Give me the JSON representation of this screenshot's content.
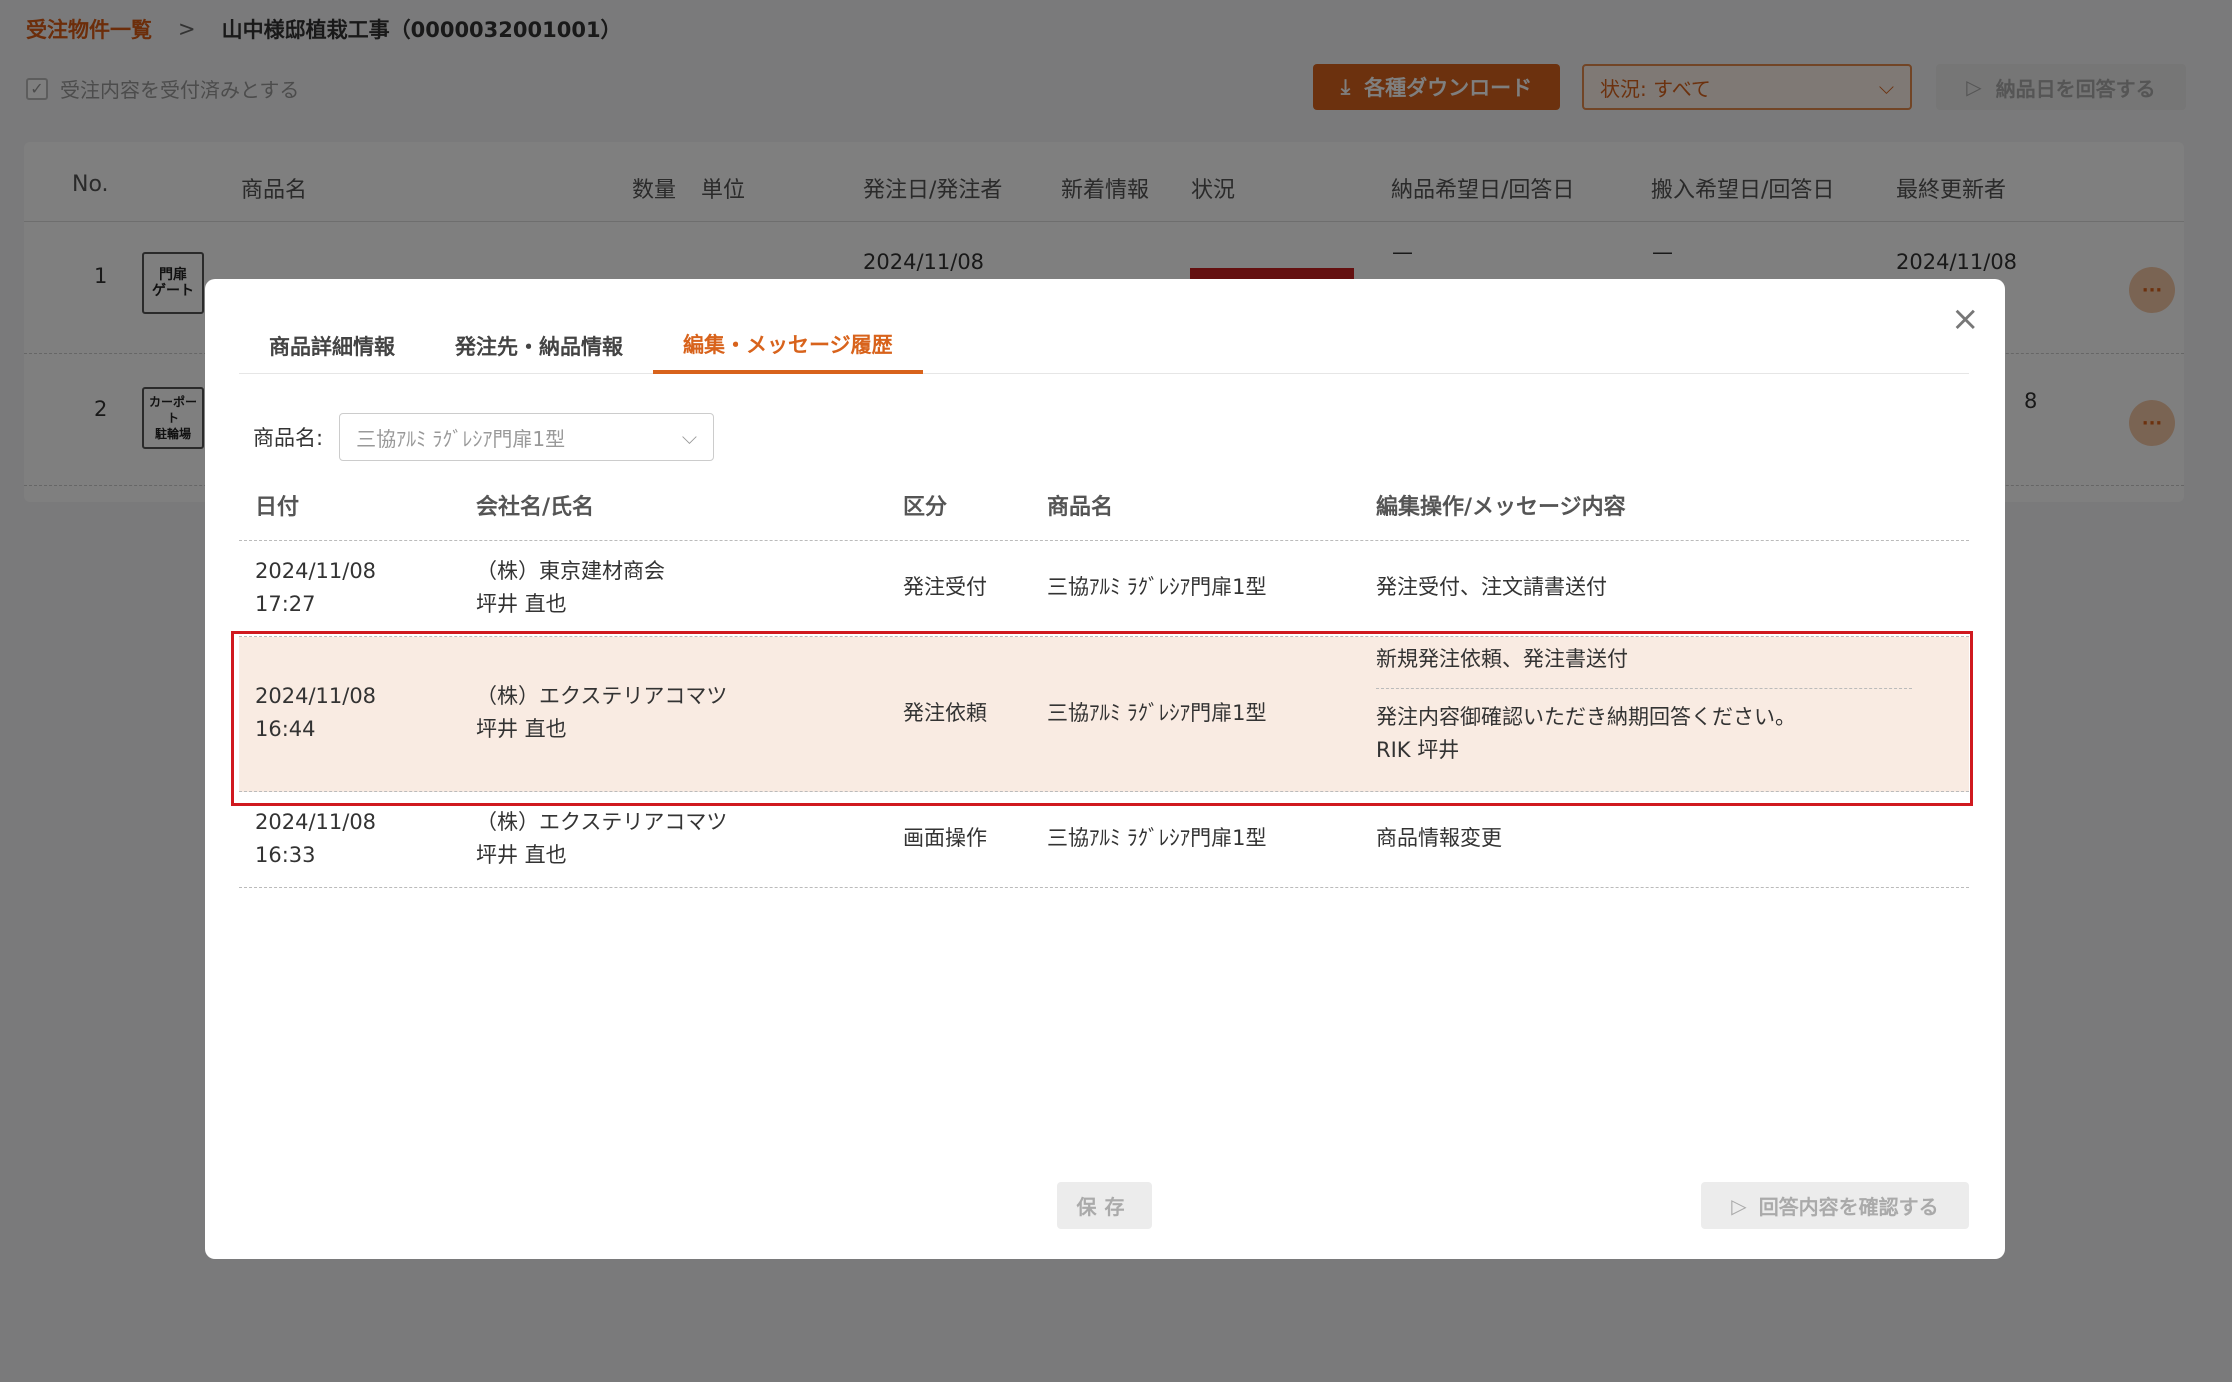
{
  "breadcrumb": {
    "parent": "受注物件一覧",
    "separator": ">",
    "current": "山中様邸植栽工事（0000032001001）"
  },
  "toolbar": {
    "accept_label": "受注内容を受付済みとする",
    "download_label": "各種ダウンロード",
    "status_filter": "状況: すべて",
    "answer_label": "納品日を回答する"
  },
  "table": {
    "headers": {
      "no": "No.",
      "product": "商品名",
      "qty": "数量",
      "unit": "単位",
      "order_date": "発注日/発注者",
      "news": "新着情報",
      "status": "状況",
      "delivery": "納品希望日/回答日",
      "carry_in": "搬入希望日/回答日",
      "updater": "最終更新者"
    },
    "rows": [
      {
        "no": "1",
        "icon_text": "門扉\nゲート",
        "order_date": "2024/11/08",
        "delivery": "—",
        "carry_in": "—",
        "updater": "2024/11/08"
      },
      {
        "no": "2",
        "icon_text": "カーポート\n駐輪場",
        "updater": "8"
      }
    ]
  },
  "modal": {
    "tabs": [
      "商品詳細情報",
      "発注先・納品情報",
      "編集・メッセージ履歴"
    ],
    "active_tab": 2,
    "filter_label": "商品名:",
    "filter_value": "三協ｱﾙﾐ ﾗｸﾞﾚｼｱ門扉1型",
    "history_headers": {
      "date": "日付",
      "company": "会社名/氏名",
      "kind": "区分",
      "product": "商品名",
      "message": "編集操作/メッセージ内容"
    },
    "history": [
      {
        "date": "2024/11/08",
        "time": "17:27",
        "company": "（株）東京建材商会",
        "person": "坪井 直也",
        "kind": "発注受付",
        "product": "三協ｱﾙﾐ ﾗｸﾞﾚｼｱ門扉1型",
        "operation": "発注受付、注文請書送付"
      },
      {
        "date": "2024/11/08",
        "time": "16:44",
        "company": "（株）エクステリアコマツ",
        "person": "坪井 直也",
        "kind": "発注依頼",
        "product": "三協ｱﾙﾐ ﾗｸﾞﾚｼｱ門扉1型",
        "operation": "新規発注依頼、発注書送付",
        "message_line1": "発注内容御確認いただき納期回答ください。",
        "message_line2": "RIK 坪井"
      },
      {
        "date": "2024/11/08",
        "time": "16:33",
        "company": "（株）エクステリアコマツ",
        "person": "坪井 直也",
        "kind": "画面操作",
        "product": "三協ｱﾙﾐ ﾗｸﾞﾚｼｱ門扉1型",
        "operation": "商品情報変更"
      }
    ],
    "save_label": "保存",
    "confirm_label": "回答内容を確認する"
  },
  "colors": {
    "accent": "#d8631c",
    "highlight_row": "#f9ebe2",
    "highlight_border": "#d0191f",
    "status_red": "#c92020"
  },
  "icons": [
    "check-icon",
    "download-icon",
    "chevron-down-icon",
    "send-icon",
    "close-icon",
    "more-icon"
  ]
}
